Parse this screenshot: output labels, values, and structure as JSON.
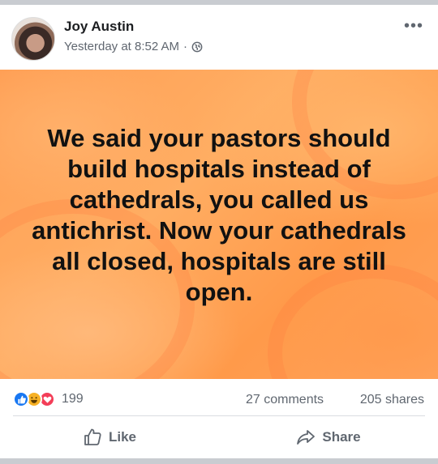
{
  "post": {
    "author": "Joy Austin",
    "timestamp": "Yesterday at 8:52 AM",
    "separator": "·",
    "privacy_icon": "globe-icon",
    "more_icon": "more-options-icon",
    "more_label": "•••",
    "image_text": "We said your pastors should build hospitals instead of cathedrals, you called us antichrist. Now your cathedrals all closed, hospitals are still open.",
    "image_colors": {
      "background": "#ffa25a",
      "text": "#111111"
    }
  },
  "stats": {
    "reaction_icons": [
      "like-reaction-icon",
      "haha-reaction-icon",
      "love-reaction-icon"
    ],
    "reaction_count": "199",
    "comments": "27 comments",
    "shares": "205 shares"
  },
  "actions": {
    "like_label": "Like",
    "share_label": "Share"
  },
  "colors": {
    "like_blue": "#1877f2",
    "haha_yellow": "#f7b125",
    "love_red": "#f33e58",
    "secondary_text": "#606770"
  }
}
